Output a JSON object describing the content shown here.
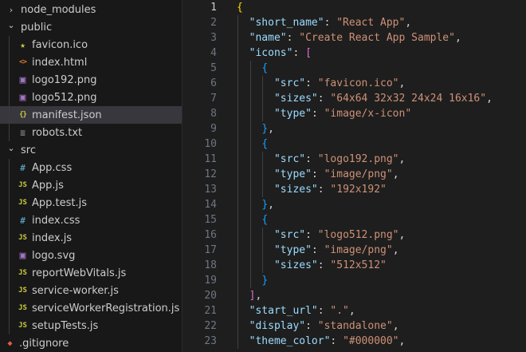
{
  "explorer": {
    "items": [
      {
        "type": "folder",
        "depth": 0,
        "open": false,
        "name": "node_modules"
      },
      {
        "type": "folder",
        "depth": 0,
        "open": true,
        "name": "public"
      },
      {
        "type": "file",
        "depth": 1,
        "icon": "star",
        "name": "favicon.ico"
      },
      {
        "type": "file",
        "depth": 1,
        "icon": "html",
        "name": "index.html"
      },
      {
        "type": "file",
        "depth": 1,
        "icon": "image",
        "name": "logo192.png"
      },
      {
        "type": "file",
        "depth": 1,
        "icon": "image",
        "name": "logo512.png"
      },
      {
        "type": "file",
        "depth": 1,
        "icon": "json",
        "name": "manifest.json",
        "selected": true
      },
      {
        "type": "file",
        "depth": 1,
        "icon": "text",
        "name": "robots.txt"
      },
      {
        "type": "folder",
        "depth": 0,
        "open": true,
        "name": "src"
      },
      {
        "type": "file",
        "depth": 1,
        "icon": "css",
        "name": "App.css"
      },
      {
        "type": "file",
        "depth": 1,
        "icon": "js",
        "name": "App.js"
      },
      {
        "type": "file",
        "depth": 1,
        "icon": "js",
        "name": "App.test.js"
      },
      {
        "type": "file",
        "depth": 1,
        "icon": "css",
        "name": "index.css"
      },
      {
        "type": "file",
        "depth": 1,
        "icon": "js",
        "name": "index.js"
      },
      {
        "type": "file",
        "depth": 1,
        "icon": "image",
        "name": "logo.svg"
      },
      {
        "type": "file",
        "depth": 1,
        "icon": "js",
        "name": "reportWebVitals.js"
      },
      {
        "type": "file",
        "depth": 1,
        "icon": "js",
        "name": "service-worker.js"
      },
      {
        "type": "file",
        "depth": 1,
        "icon": "js",
        "name": "serviceWorkerRegistration.js"
      },
      {
        "type": "file",
        "depth": 1,
        "icon": "js",
        "name": "setupTests.js"
      },
      {
        "type": "file",
        "depth": 0,
        "icon": "git",
        "name": ".gitignore"
      }
    ],
    "icon_glyphs": {
      "star": "★",
      "html": "<>",
      "image": "▣",
      "json": "{}",
      "text": "≡",
      "css": "#",
      "js": "JS",
      "git": "◆"
    },
    "icon_colors": {
      "star": "#cbcb41",
      "html": "#e37933",
      "image": "#a074c4",
      "json": "#cbcb41",
      "text": "#8d8d8d",
      "css": "#519aba",
      "js": "#cbcb41",
      "git": "#41535b"
    },
    "twist_open": "⌄",
    "twist_closed": "›"
  },
  "editor": {
    "active_line": 1,
    "lines": [
      {
        "n": 1,
        "tokens": [
          [
            "br1",
            "{"
          ]
        ]
      },
      {
        "n": 2,
        "tokens": [
          [
            "ws",
            "  "
          ],
          [
            "key",
            "\"short_name\""
          ],
          [
            "punct",
            ": "
          ],
          [
            "str",
            "\"React App\""
          ],
          [
            "punct",
            ","
          ]
        ]
      },
      {
        "n": 3,
        "tokens": [
          [
            "ws",
            "  "
          ],
          [
            "key",
            "\"name\""
          ],
          [
            "punct",
            ": "
          ],
          [
            "str",
            "\"Create React App Sample\""
          ],
          [
            "punct",
            ","
          ]
        ]
      },
      {
        "n": 4,
        "tokens": [
          [
            "ws",
            "  "
          ],
          [
            "key",
            "\"icons\""
          ],
          [
            "punct",
            ": "
          ],
          [
            "br2",
            "["
          ]
        ]
      },
      {
        "n": 5,
        "tokens": [
          [
            "ws",
            "    "
          ],
          [
            "br3",
            "{"
          ]
        ]
      },
      {
        "n": 6,
        "tokens": [
          [
            "ws",
            "      "
          ],
          [
            "key",
            "\"src\""
          ],
          [
            "punct",
            ": "
          ],
          [
            "str",
            "\"favicon.ico\""
          ],
          [
            "punct",
            ","
          ]
        ]
      },
      {
        "n": 7,
        "tokens": [
          [
            "ws",
            "      "
          ],
          [
            "key",
            "\"sizes\""
          ],
          [
            "punct",
            ": "
          ],
          [
            "str",
            "\"64x64 32x32 24x24 16x16\""
          ],
          [
            "punct",
            ","
          ]
        ]
      },
      {
        "n": 8,
        "tokens": [
          [
            "ws",
            "      "
          ],
          [
            "key",
            "\"type\""
          ],
          [
            "punct",
            ": "
          ],
          [
            "str",
            "\"image/x-icon\""
          ]
        ]
      },
      {
        "n": 9,
        "tokens": [
          [
            "ws",
            "    "
          ],
          [
            "br3",
            "}"
          ],
          [
            "punct",
            ","
          ]
        ]
      },
      {
        "n": 10,
        "tokens": [
          [
            "ws",
            "    "
          ],
          [
            "br3",
            "{"
          ]
        ]
      },
      {
        "n": 11,
        "tokens": [
          [
            "ws",
            "      "
          ],
          [
            "key",
            "\"src\""
          ],
          [
            "punct",
            ": "
          ],
          [
            "str",
            "\"logo192.png\""
          ],
          [
            "punct",
            ","
          ]
        ]
      },
      {
        "n": 12,
        "tokens": [
          [
            "ws",
            "      "
          ],
          [
            "key",
            "\"type\""
          ],
          [
            "punct",
            ": "
          ],
          [
            "str",
            "\"image/png\""
          ],
          [
            "punct",
            ","
          ]
        ]
      },
      {
        "n": 13,
        "tokens": [
          [
            "ws",
            "      "
          ],
          [
            "key",
            "\"sizes\""
          ],
          [
            "punct",
            ": "
          ],
          [
            "str",
            "\"192x192\""
          ]
        ]
      },
      {
        "n": 14,
        "tokens": [
          [
            "ws",
            "    "
          ],
          [
            "br3",
            "}"
          ],
          [
            "punct",
            ","
          ]
        ]
      },
      {
        "n": 15,
        "tokens": [
          [
            "ws",
            "    "
          ],
          [
            "br3",
            "{"
          ]
        ]
      },
      {
        "n": 16,
        "tokens": [
          [
            "ws",
            "      "
          ],
          [
            "key",
            "\"src\""
          ],
          [
            "punct",
            ": "
          ],
          [
            "str",
            "\"logo512.png\""
          ],
          [
            "punct",
            ","
          ]
        ]
      },
      {
        "n": 17,
        "tokens": [
          [
            "ws",
            "      "
          ],
          [
            "key",
            "\"type\""
          ],
          [
            "punct",
            ": "
          ],
          [
            "str",
            "\"image/png\""
          ],
          [
            "punct",
            ","
          ]
        ]
      },
      {
        "n": 18,
        "tokens": [
          [
            "ws",
            "      "
          ],
          [
            "key",
            "\"sizes\""
          ],
          [
            "punct",
            ": "
          ],
          [
            "str",
            "\"512x512\""
          ]
        ]
      },
      {
        "n": 19,
        "tokens": [
          [
            "ws",
            "    "
          ],
          [
            "br3",
            "}"
          ]
        ]
      },
      {
        "n": 20,
        "tokens": [
          [
            "ws",
            "  "
          ],
          [
            "br2",
            "]"
          ],
          [
            "punct",
            ","
          ]
        ]
      },
      {
        "n": 21,
        "tokens": [
          [
            "ws",
            "  "
          ],
          [
            "key",
            "\"start_url\""
          ],
          [
            "punct",
            ": "
          ],
          [
            "str",
            "\".\""
          ],
          [
            "punct",
            ","
          ]
        ]
      },
      {
        "n": 22,
        "tokens": [
          [
            "ws",
            "  "
          ],
          [
            "key",
            "\"display\""
          ],
          [
            "punct",
            ": "
          ],
          [
            "str",
            "\"standalone\""
          ],
          [
            "punct",
            ","
          ]
        ]
      },
      {
        "n": 23,
        "tokens": [
          [
            "ws",
            "  "
          ],
          [
            "key",
            "\"theme_color\""
          ],
          [
            "punct",
            ": "
          ],
          [
            "str",
            "\"#000000\""
          ],
          [
            "punct",
            ","
          ]
        ]
      }
    ]
  }
}
